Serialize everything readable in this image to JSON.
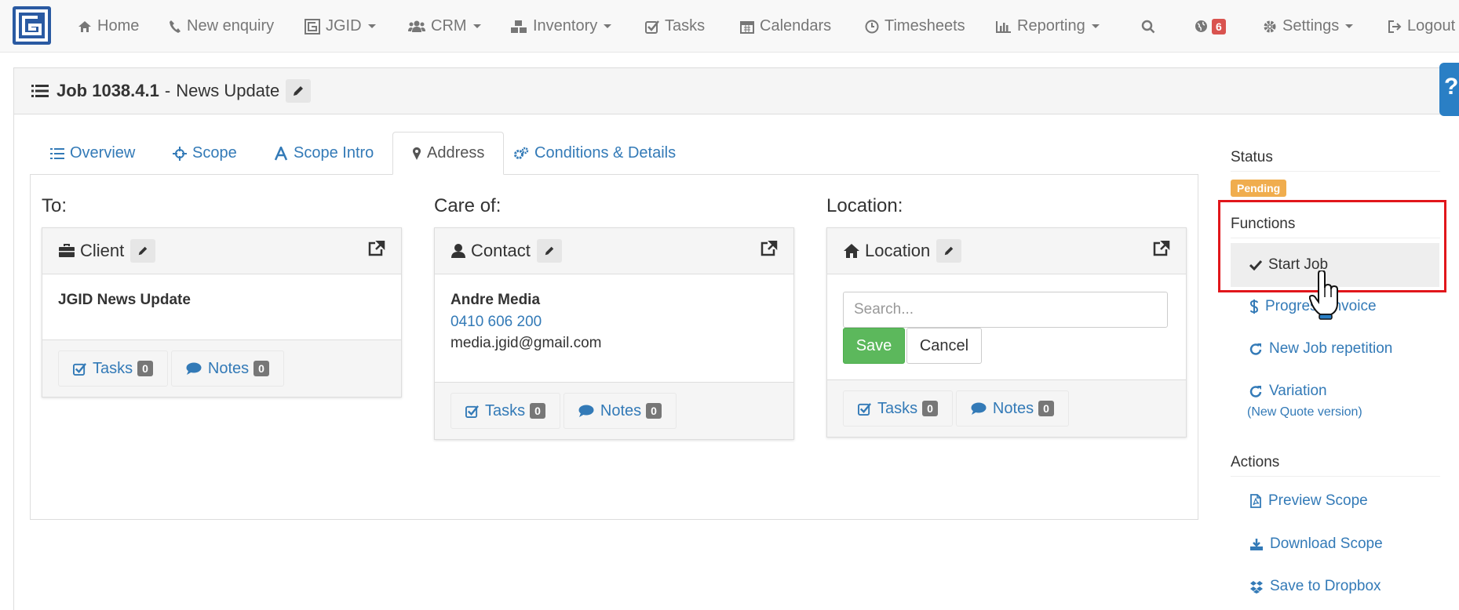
{
  "nav": {
    "home": "Home",
    "new_enquiry": "New enquiry",
    "jgid": "JGID",
    "crm": "CRM",
    "inventory": "Inventory",
    "tasks": "Tasks",
    "calendars": "Calendars",
    "timesheets": "Timesheets",
    "reporting": "Reporting",
    "notifications_count": "6",
    "settings": "Settings",
    "logout": "Logout"
  },
  "page": {
    "job_id": "Job 1038.4.1",
    "separator": "-",
    "job_name": "News Update",
    "help_label": "?"
  },
  "tabs": [
    {
      "label": "Overview"
    },
    {
      "label": "Scope"
    },
    {
      "label": "Scope Intro"
    },
    {
      "label": "Address"
    },
    {
      "label": "Conditions & Details"
    }
  ],
  "address": {
    "to": {
      "title": "To:",
      "panel_label": "Client",
      "name": "JGID News Update",
      "tasks_label": "Tasks",
      "tasks_count": "0",
      "notes_label": "Notes",
      "notes_count": "0"
    },
    "care_of": {
      "title": "Care of:",
      "panel_label": "Contact",
      "name": "Andre Media",
      "phone": "0410 606 200",
      "email": "media.jgid@gmail.com",
      "tasks_label": "Tasks",
      "tasks_count": "0",
      "notes_label": "Notes",
      "notes_count": "0"
    },
    "location": {
      "title": "Location:",
      "panel_label": "Location",
      "search_placeholder": "Search...",
      "save_label": "Save",
      "cancel_label": "Cancel",
      "tasks_label": "Tasks",
      "tasks_count": "0",
      "notes_label": "Notes",
      "notes_count": "0"
    }
  },
  "sidebar": {
    "status_heading": "Status",
    "status_value": "Pending",
    "functions_heading": "Functions",
    "functions": [
      {
        "label": "Start Job",
        "icon": "check-icon"
      },
      {
        "label": "Progress Invoice",
        "icon": "dollar-icon"
      },
      {
        "label": "New Job repetition",
        "icon": "refresh-icon"
      },
      {
        "label": "Variation",
        "sub": "(New Quote version)",
        "icon": "refresh-icon"
      }
    ],
    "actions_heading": "Actions",
    "actions": [
      {
        "label": "Preview Scope",
        "icon": "pdf-icon"
      },
      {
        "label": "Download Scope",
        "icon": "download-icon"
      },
      {
        "label": "Save to Dropbox",
        "icon": "dropbox-icon"
      }
    ]
  },
  "colors": {
    "link": "#337ab7",
    "status_pending": "#f0ad4e",
    "save_green": "#5cb85c",
    "highlight_red": "#e1161b",
    "brand_blue": "#2a5aa2"
  }
}
